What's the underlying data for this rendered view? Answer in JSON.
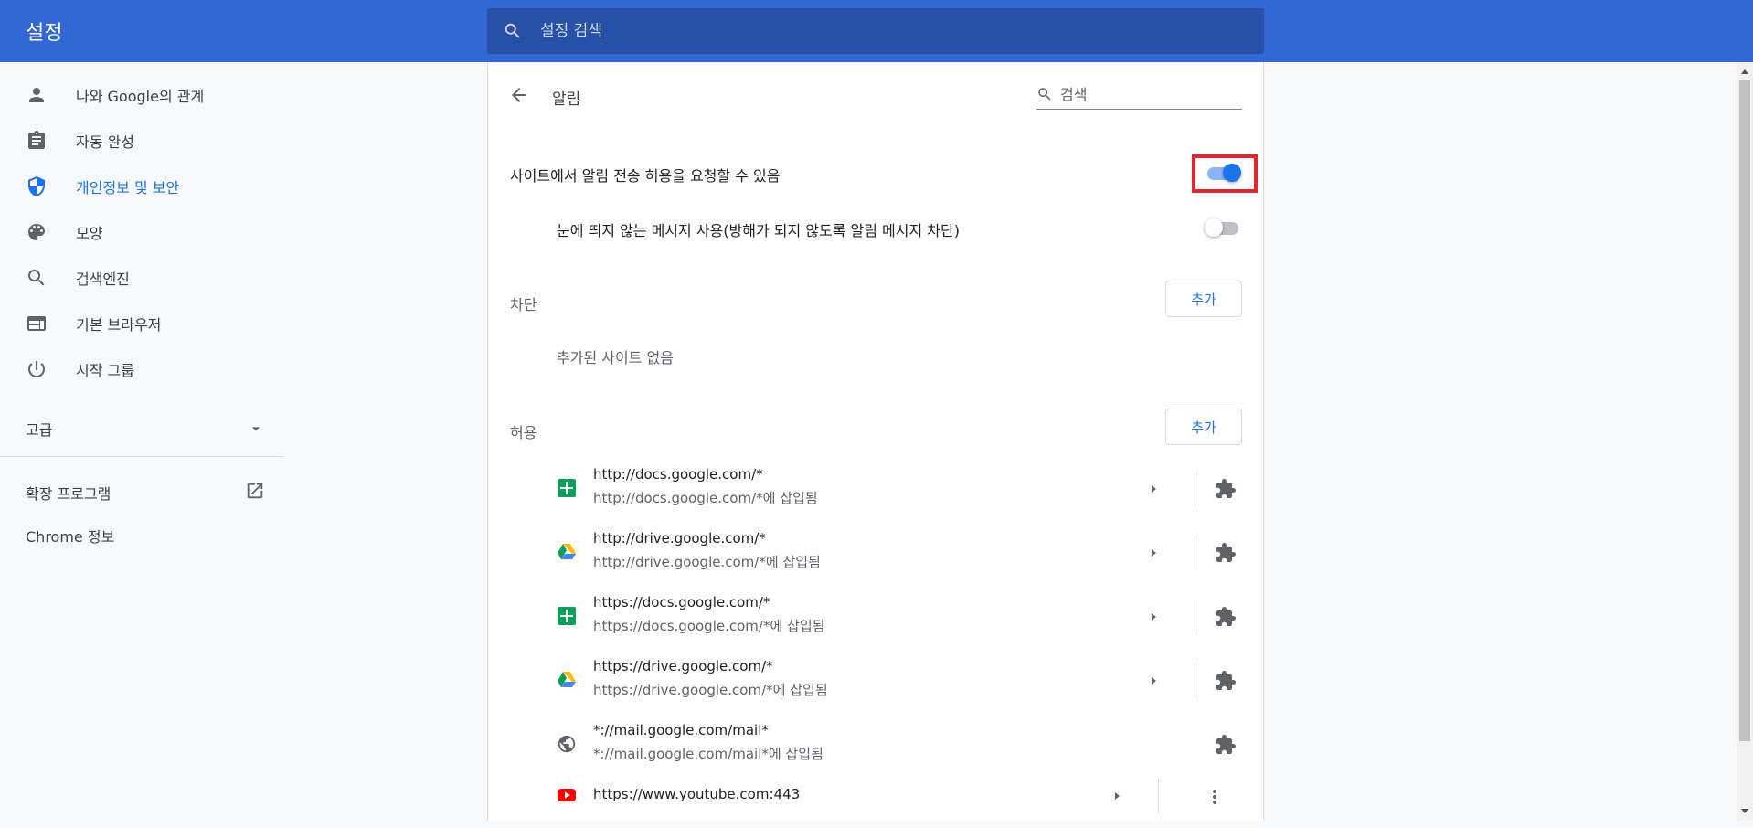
{
  "header": {
    "title": "설정",
    "search_placeholder": "설정 검색"
  },
  "sidebar": {
    "items": [
      {
        "label": "나와 Google의 관계",
        "icon": "person-icon"
      },
      {
        "label": "자동 완성",
        "icon": "clipboard-icon"
      },
      {
        "label": "개인정보 및 보안",
        "icon": "shield-icon",
        "active": true
      },
      {
        "label": "모양",
        "icon": "palette-icon"
      },
      {
        "label": "검색엔진",
        "icon": "search-icon"
      },
      {
        "label": "기본 브라우저",
        "icon": "browser-icon"
      },
      {
        "label": "시작 그룹",
        "icon": "power-icon"
      }
    ],
    "advanced": "고급",
    "extensions": "확장 프로그램",
    "about": "Chrome 정보"
  },
  "page": {
    "title": "알림",
    "search_placeholder": "검색",
    "ask_toggle_label": "사이트에서 알림 전송 허용을 요청할 수 있음",
    "ask_toggle_on": true,
    "quiet_toggle_label": "눈에 띄지 않는 메시지 사용(방해가 되지 않도록 알림 메시지 차단)",
    "quiet_toggle_on": false,
    "block_section": "차단",
    "block_add": "추가",
    "block_empty": "추가된 사이트 없음",
    "allow_section": "허용",
    "allow_add": "추가",
    "sites": [
      {
        "url": "http://docs.google.com/*",
        "sub": "http://docs.google.com/*에 삽입됨",
        "favicon": "sheets-icon"
      },
      {
        "url": "http://drive.google.com/*",
        "sub": "http://drive.google.com/*에 삽입됨",
        "favicon": "drive-icon"
      },
      {
        "url": "https://docs.google.com/*",
        "sub": "https://docs.google.com/*에 삽입됨",
        "favicon": "sheets-icon"
      },
      {
        "url": "https://drive.google.com/*",
        "sub": "https://drive.google.com/*에 삽입됨",
        "favicon": "drive-icon"
      },
      {
        "url": "*://mail.google.com/mail*",
        "sub": "*://mail.google.com/mail*에 삽입됨",
        "favicon": "globe-icon"
      },
      {
        "url": "https://www.youtube.com:443",
        "sub": "",
        "favicon": "youtube-icon"
      }
    ]
  },
  "colors": {
    "header": "#3367d6",
    "accent": "#1a73e8",
    "highlight": "#e3262e"
  }
}
